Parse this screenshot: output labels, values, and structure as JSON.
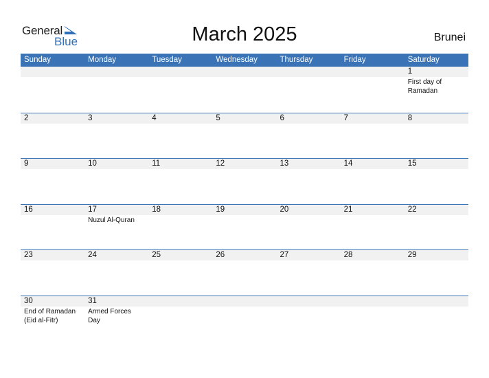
{
  "logo": {
    "text_general": "General",
    "text_blue": "Blue",
    "brand_color": "#2f6fb8"
  },
  "header": {
    "title": "March 2025",
    "country": "Brunei"
  },
  "colors": {
    "header_bg": "#3a74b6",
    "date_band": "#f1f1f1"
  },
  "weekdays": [
    "Sunday",
    "Monday",
    "Tuesday",
    "Wednesday",
    "Thursday",
    "Friday",
    "Saturday"
  ],
  "weeks": [
    [
      {
        "day": "",
        "event": ""
      },
      {
        "day": "",
        "event": ""
      },
      {
        "day": "",
        "event": ""
      },
      {
        "day": "",
        "event": ""
      },
      {
        "day": "",
        "event": ""
      },
      {
        "day": "",
        "event": ""
      },
      {
        "day": "1",
        "event": "First day of Ramadan"
      }
    ],
    [
      {
        "day": "2",
        "event": ""
      },
      {
        "day": "3",
        "event": ""
      },
      {
        "day": "4",
        "event": ""
      },
      {
        "day": "5",
        "event": ""
      },
      {
        "day": "6",
        "event": ""
      },
      {
        "day": "7",
        "event": ""
      },
      {
        "day": "8",
        "event": ""
      }
    ],
    [
      {
        "day": "9",
        "event": ""
      },
      {
        "day": "10",
        "event": ""
      },
      {
        "day": "11",
        "event": ""
      },
      {
        "day": "12",
        "event": ""
      },
      {
        "day": "13",
        "event": ""
      },
      {
        "day": "14",
        "event": ""
      },
      {
        "day": "15",
        "event": ""
      }
    ],
    [
      {
        "day": "16",
        "event": ""
      },
      {
        "day": "17",
        "event": "Nuzul Al-Quran"
      },
      {
        "day": "18",
        "event": ""
      },
      {
        "day": "19",
        "event": ""
      },
      {
        "day": "20",
        "event": ""
      },
      {
        "day": "21",
        "event": ""
      },
      {
        "day": "22",
        "event": ""
      }
    ],
    [
      {
        "day": "23",
        "event": ""
      },
      {
        "day": "24",
        "event": ""
      },
      {
        "day": "25",
        "event": ""
      },
      {
        "day": "26",
        "event": ""
      },
      {
        "day": "27",
        "event": ""
      },
      {
        "day": "28",
        "event": ""
      },
      {
        "day": "29",
        "event": ""
      }
    ],
    [
      {
        "day": "30",
        "event": "End of Ramadan (Eid al-Fitr)"
      },
      {
        "day": "31",
        "event": "Armed Forces Day"
      },
      {
        "day": "",
        "event": ""
      },
      {
        "day": "",
        "event": ""
      },
      {
        "day": "",
        "event": ""
      },
      {
        "day": "",
        "event": ""
      },
      {
        "day": "",
        "event": ""
      }
    ]
  ]
}
